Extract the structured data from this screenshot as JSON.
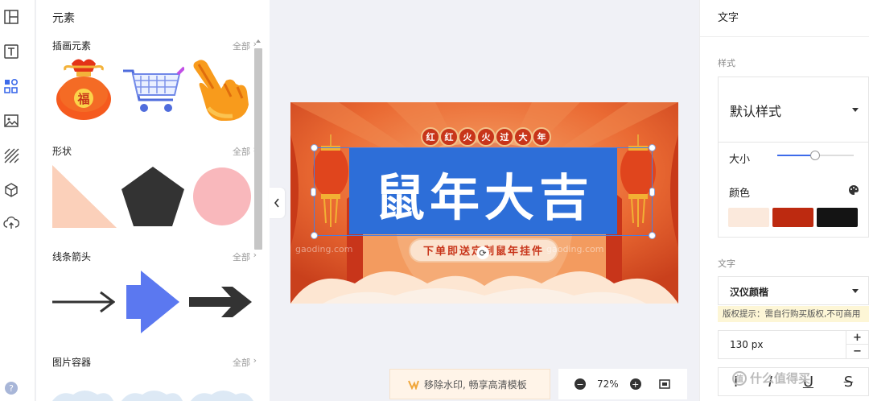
{
  "left_panel": {
    "title": "元素",
    "sections": [
      {
        "title": "插画元素",
        "see_all": "全部"
      },
      {
        "title": "形状",
        "see_all": "全部"
      },
      {
        "title": "线条箭头",
        "see_all": "全部"
      },
      {
        "title": "图片容器",
        "see_all": "全部"
      }
    ],
    "illustration_badge": "福"
  },
  "poster": {
    "banner_chars": [
      "红",
      "红",
      "火",
      "火",
      "过",
      "大",
      "年"
    ],
    "main_title": "鼠年大吉",
    "subtitle": "下单即送定制鼠年挂件",
    "watermark_text": "gaoding.com"
  },
  "bottom_bar": {
    "watermark_button": "移除水印, 畅享高清模板",
    "zoom_level": "72%"
  },
  "right_panel": {
    "title": "文字",
    "style_label": "样式",
    "style_value": "默认样式",
    "size_label": "大小",
    "size_slider_fraction": 0.45,
    "color_label": "颜色",
    "swatches": [
      "#fbe9dc",
      "#bd2a10",
      "#141414"
    ],
    "text_label": "文字",
    "font_value": "汉仪颜楷",
    "copyright_notice": "版权提示：需自行购买版权,不可商用",
    "font_size_value": "130 px",
    "step_up": "+",
    "step_down": "−",
    "format_glyphs": [
      "I",
      "I",
      "U",
      "S"
    ]
  },
  "site_watermark": "什么值得买",
  "colors": {
    "accent": "#3d6bea",
    "poster_orange": "#e8703d",
    "poster_red": "#c8351a",
    "poster_blue": "#2d6ed8"
  }
}
